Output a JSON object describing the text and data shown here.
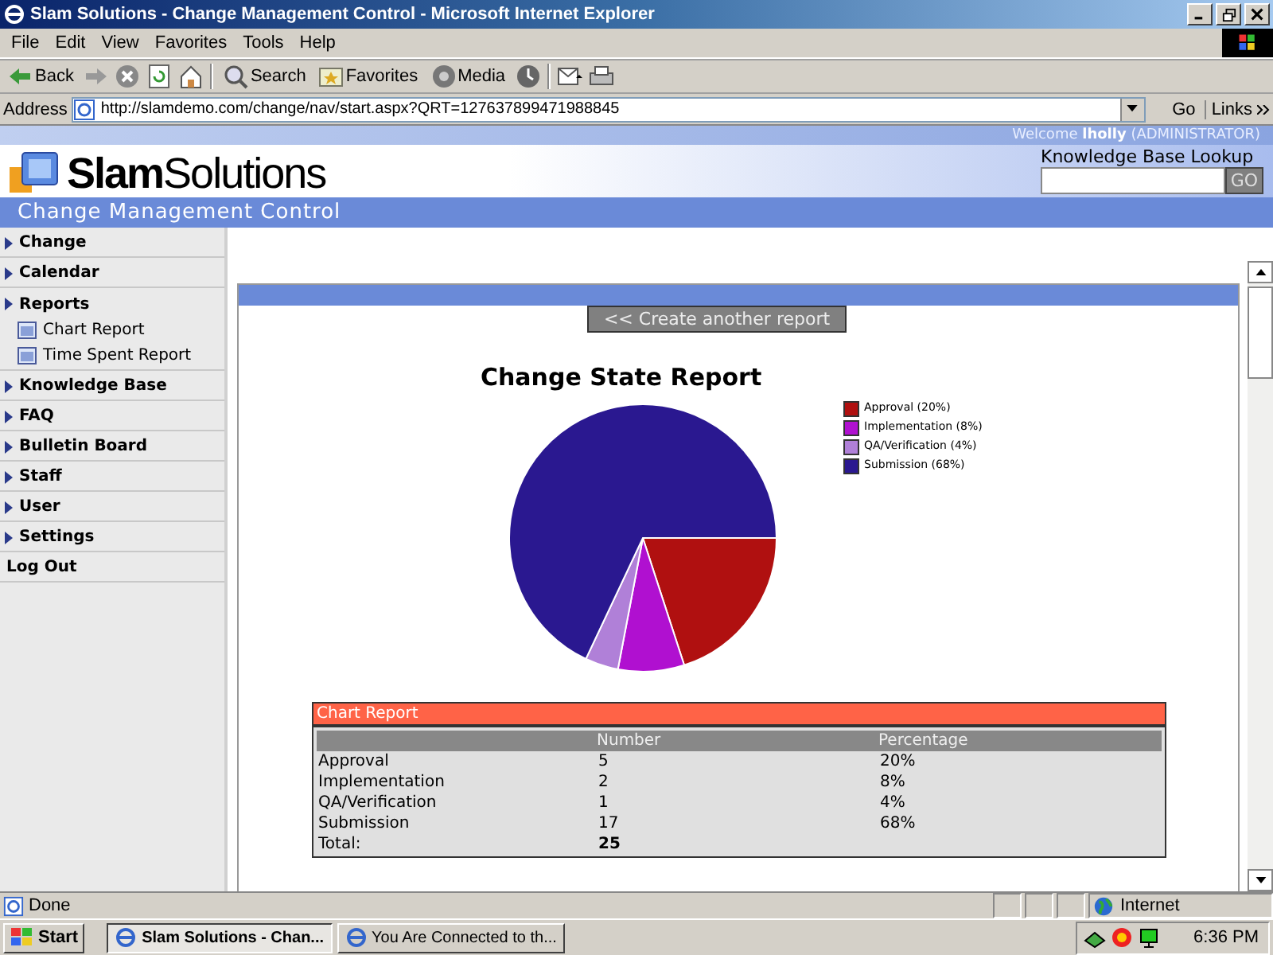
{
  "window": {
    "title": "Slam Solutions - Change Management Control - Microsoft Internet Explorer"
  },
  "menu": [
    "File",
    "Edit",
    "View",
    "Favorites",
    "Tools",
    "Help"
  ],
  "toolbar": [
    {
      "kind": "back",
      "label": "Back"
    },
    {
      "kind": "forward"
    },
    {
      "kind": "stop"
    },
    {
      "kind": "refresh"
    },
    {
      "kind": "home"
    },
    {
      "kind": "search",
      "label": "Search"
    },
    {
      "kind": "favorites",
      "label": "Favorites"
    },
    {
      "kind": "media",
      "label": "Media"
    },
    {
      "kind": "history"
    },
    {
      "kind": "mail"
    },
    {
      "kind": "print"
    }
  ],
  "address": {
    "label": "Address",
    "url": "http://slamdemo.com/change/nav/start.aspx?QRT=127637899471988845",
    "go": "Go",
    "links": "Links"
  },
  "header": {
    "welcome": "Welcome **lholly** (ADMINISTRATOR)",
    "logo": "**Slam**Solutions",
    "subtitle": "Change Management Control",
    "lookup_label": "Knowledge Base Lookup",
    "lookup_button": "GO"
  },
  "sidebar": {
    "items": [
      {
        "kind": "section",
        "label": "Change"
      },
      {
        "kind": "section",
        "label": "Calendar"
      },
      {
        "kind": "section",
        "label": "Reports",
        "children": [
          {
            "label": "Chart Report"
          },
          {
            "label": "Time Spent Report"
          }
        ]
      },
      {
        "kind": "section",
        "label": "Knowledge Base"
      },
      {
        "kind": "section",
        "label": "FAQ"
      },
      {
        "kind": "section",
        "label": "Bulletin Board"
      },
      {
        "kind": "section",
        "label": "Staff"
      },
      {
        "kind": "section",
        "label": "User"
      },
      {
        "kind": "section",
        "label": "Settings"
      },
      {
        "kind": "link",
        "label": "Log Out"
      }
    ]
  },
  "report": {
    "back_button": "<< Create another report",
    "chart": {
      "legend": [
        {
          "color": "#b01010"
        },
        {
          "color": "#b010d0"
        },
        {
          "color": "#b080d8"
        },
        {
          "color": "#2a1890"
        }
      ],
      "chart_data": {
        "type": "pie",
        "title": "Change State Report",
        "categories": [
          "Approval (20%)",
          "Implementation (8%)",
          "QA/Verification (4%)",
          "Submission (68%)"
        ],
        "values": [
          20,
          8,
          4,
          68
        ],
        "legend": "right"
      }
    },
    "table": {
      "title": "Chart Report",
      "columns": [
        "Number",
        "Percentage"
      ],
      "rows": [
        {
          "label": "Approval",
          "number": "5",
          "percentage": "20%"
        },
        {
          "label": "Implementation",
          "number": "2",
          "percentage": "8%"
        },
        {
          "label": "QA/Verification",
          "number": "1",
          "percentage": "4%"
        },
        {
          "label": "Submission",
          "number": "17",
          "percentage": "68%"
        }
      ],
      "total": {
        "label": "Total:",
        "value": "25"
      }
    }
  },
  "status_bar": {
    "text": "Done",
    "zone": "Internet"
  },
  "taskbar": {
    "start": "Start",
    "tasks": [
      {
        "label": "Slam Solutions - Chan...",
        "selected": true
      },
      {
        "label": "You Are Connected to th...",
        "selected": false
      }
    ],
    "clock": "6:36 PM"
  }
}
